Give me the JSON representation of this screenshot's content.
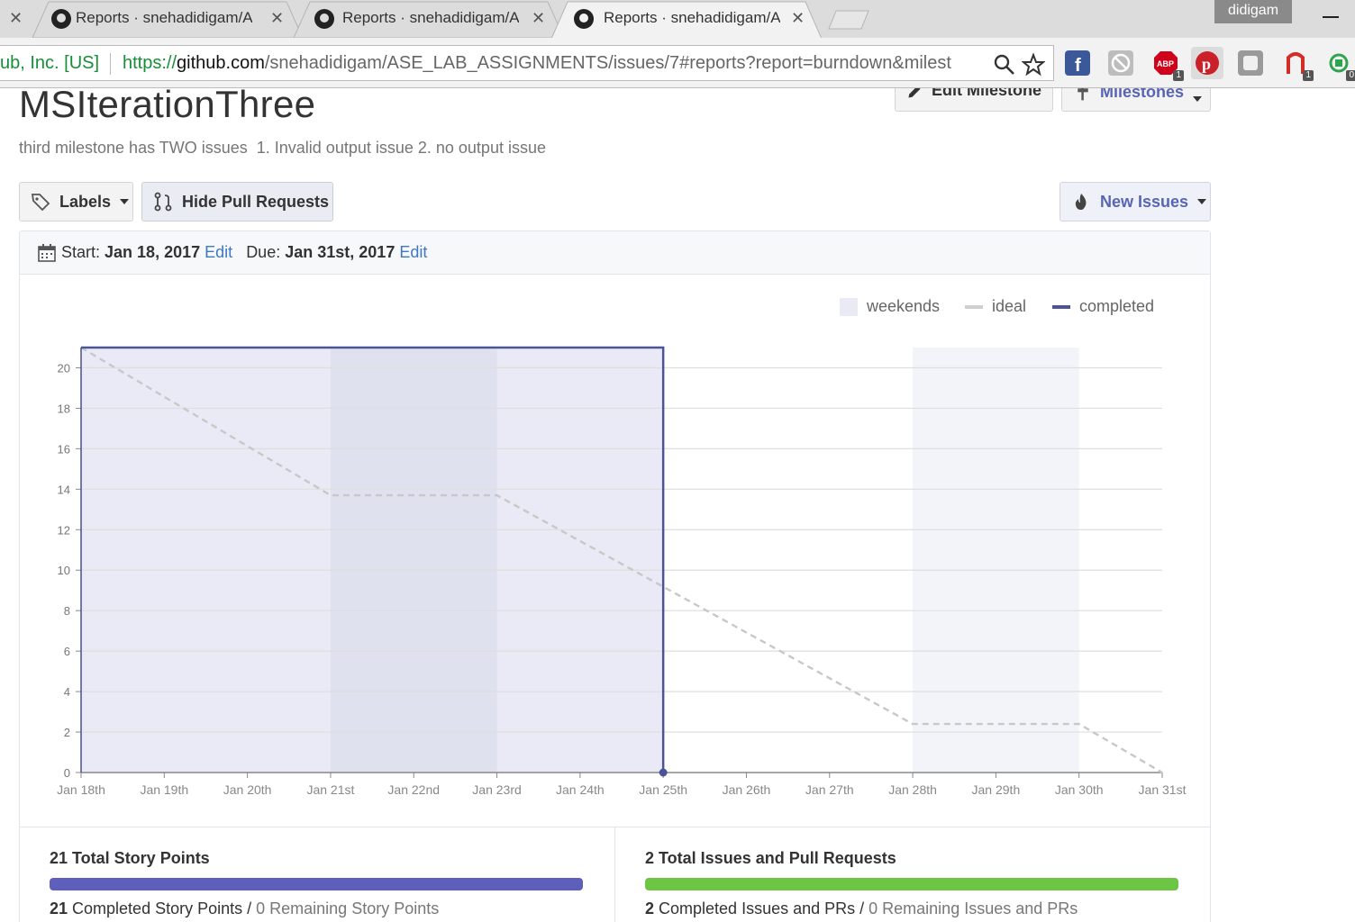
{
  "browser": {
    "tabs": [
      {
        "title": "Reports · snehadidigam/A",
        "active": false
      },
      {
        "title": "Reports · snehadidigam/A",
        "active": false
      },
      {
        "title": "Reports · snehadidigam/A",
        "active": true
      }
    ],
    "close_glyph": "✕",
    "profile_name": "didigam",
    "cert_label": "ub, Inc. [US]",
    "url_scheme": "https://",
    "url_host": "github.com",
    "url_rest": "/snehadidigam/ASE_LAB_ASSIGNMENTS/issues/7#reports?report=burndown&milest",
    "extensions": [
      {
        "name": "facebook-icon",
        "color": "#3b5998",
        "badge": ""
      },
      {
        "name": "blocker-icon",
        "color": "#a0a0a0",
        "badge": ""
      },
      {
        "name": "adblock-icon",
        "color": "#d0021b",
        "badge": "1"
      },
      {
        "name": "pinterest-icon",
        "color": "#cb2027",
        "badge": ""
      },
      {
        "name": "shield-icon",
        "color": "#9a9a9a",
        "badge": ""
      },
      {
        "name": "lastpass-icon",
        "color": "#d32d27",
        "badge": "1"
      },
      {
        "name": "sync-icon",
        "color": "#2ea44f",
        "badge": "0"
      }
    ]
  },
  "milestone": {
    "title": "MSIterationThree",
    "description": "third milestone has TWO issues  1. Invalid output issue 2. no output issue",
    "edit_label": "Edit Milestone",
    "milestones_label": "Milestones"
  },
  "toolbar": {
    "labels_label": "Labels",
    "hide_prs_label": "Hide Pull Requests",
    "new_issues_label": "New Issues"
  },
  "dates": {
    "start_prefix": "Start:",
    "start": "Jan 18, 2017",
    "due_prefix": "Due:",
    "due": "Jan 31st, 2017",
    "edit_link": "Edit"
  },
  "legend": {
    "weekends": "weekends",
    "ideal": "ideal",
    "completed": "completed"
  },
  "colors": {
    "completed": "#4a5497",
    "completed_fill": "#e9eaf5",
    "weekend": "#dfe1ef",
    "weekend_light": "#f3f4fa",
    "ideal": "#c8c8c8",
    "story_bar": "#5e5fba",
    "issues_bar": "#6cc644"
  },
  "chart_data": {
    "type": "line",
    "x": [
      "Jan 18th",
      "Jan 19th",
      "Jan 20th",
      "Jan 21st",
      "Jan 22nd",
      "Jan 23rd",
      "Jan 24th",
      "Jan 25th",
      "Jan 26th",
      "Jan 27th",
      "Jan 28th",
      "Jan 29th",
      "Jan 30th",
      "Jan 31st"
    ],
    "ylim": [
      0,
      21
    ],
    "yticks": [
      0,
      2,
      4,
      6,
      8,
      10,
      12,
      14,
      16,
      18,
      20
    ],
    "weekends": [
      [
        "Jan 21st",
        "Jan 23rd"
      ],
      [
        "Jan 28th",
        "Jan 30th"
      ]
    ],
    "series": [
      {
        "name": "ideal",
        "style": "dashed",
        "points": [
          [
            0,
            21
          ],
          [
            3,
            13.7
          ],
          [
            5,
            13.7
          ],
          [
            10,
            2.4
          ],
          [
            12,
            2.4
          ],
          [
            13,
            0
          ]
        ]
      },
      {
        "name": "completed",
        "style": "step",
        "points": [
          [
            0,
            21
          ],
          [
            7,
            21
          ],
          [
            7,
            0
          ]
        ]
      }
    ]
  },
  "stats": {
    "story": {
      "title": "21 Total Story Points",
      "completed_count": "21",
      "completed_text": " Completed Story Points / ",
      "remaining_count": "0",
      "remaining_text": " Remaining Story Points",
      "progress": 1.0
    },
    "issues": {
      "title": "2 Total Issues and Pull Requests",
      "completed_count": "2",
      "completed_text": " Completed Issues and PRs / ",
      "remaining_count": "0",
      "remaining_text": " Remaining Issues and PRs",
      "progress": 1.0
    }
  }
}
